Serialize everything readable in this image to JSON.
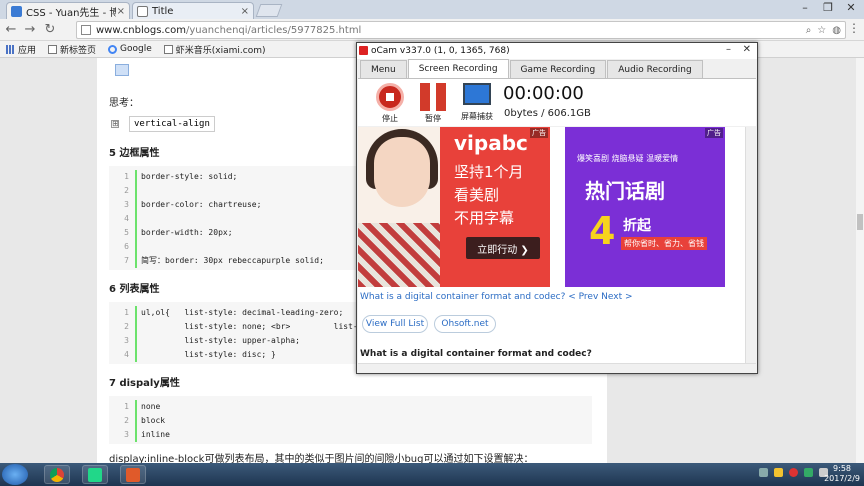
{
  "browser": {
    "tabs": [
      {
        "title": "CSS - Yuan先生 - 博客园",
        "active": true
      },
      {
        "title": "Title",
        "active": false
      }
    ],
    "close_glyph": "×",
    "url_host": "www.cnblogs.com",
    "url_path": "/yuanchenqi/articles/5977825.html",
    "bookmarks": [
      "应用",
      "新标签页",
      "Google",
      "虾米音乐(xiami.com)"
    ]
  },
  "article": {
    "thinking_label": "思考：",
    "inline_code": "vertical-align",
    "expand_glyph": "⊞",
    "section5": "5   边框属性",
    "border_code": [
      {
        "n": "1",
        "text": "border-style: solid;"
      },
      {
        "n": "2",
        "text": ""
      },
      {
        "n": "3",
        "text": "border-color: chartreuse;"
      },
      {
        "n": "4",
        "text": ""
      },
      {
        "n": "5",
        "text": "border-width: 20px;"
      },
      {
        "n": "6",
        "text": ""
      },
      {
        "n": "7",
        "text": "简写：border: 30px rebeccapurple solid;"
      }
    ],
    "section6": "6   列表属性",
    "list_code": [
      {
        "n": "1",
        "text": "ul,ol{   list-style: decimal-leading-zero;"
      },
      {
        "n": "2",
        "text": "         list-style: none; <br>         list-s"
      },
      {
        "n": "3",
        "text": "         list-style: upper-alpha;"
      },
      {
        "n": "4",
        "text": "         list-style: disc; }"
      }
    ],
    "section7": "7  dispaly属性",
    "display_code": [
      {
        "n": "1",
        "text": "none"
      },
      {
        "n": "2",
        "text": "block"
      },
      {
        "n": "3",
        "text": "inline"
      }
    ],
    "footer_text": "display:inline-block可做列表布局，其中的类似于图片间的间隙小bug可以通过如下设置解决："
  },
  "ocam": {
    "title": "oCam v337.0 (1, 0, 1365, 768)",
    "tabs": [
      "Menu",
      "Screen Recording",
      "Game Recording",
      "Audio Recording"
    ],
    "active_tab": "Screen Recording",
    "stop_label": "停止",
    "pause_label": "暂停",
    "capture_label": "屏幕捕获",
    "timer": "00:00:00",
    "storage": "0bytes / 606.1GB",
    "capture": {
      "ad_badge": "广告",
      "ad1_brand": "vipabc",
      "ad1_line1": "坚持1个月",
      "ad1_line2": "看美剧",
      "ad1_line3": "不用字幕",
      "ad1_cta": "立即行动 ❯",
      "ad2_tags": "爆笑喜剧  烧脑悬疑  温暖爱情",
      "ad2_big": "热门话剧",
      "ad2_four": "4",
      "ad2_zhe": "折起",
      "ad2_sub": "帮你省时、省力、省钱",
      "link_text": "What is a digital container format and codec?   < Prev Next >",
      "btn_full_list": "View Full List",
      "btn_ohsoft": "Ohsoft.net",
      "question": "What is a digital container format and codec?"
    }
  },
  "taskbar": {
    "time": "9:58",
    "date": "2017/2/9"
  }
}
